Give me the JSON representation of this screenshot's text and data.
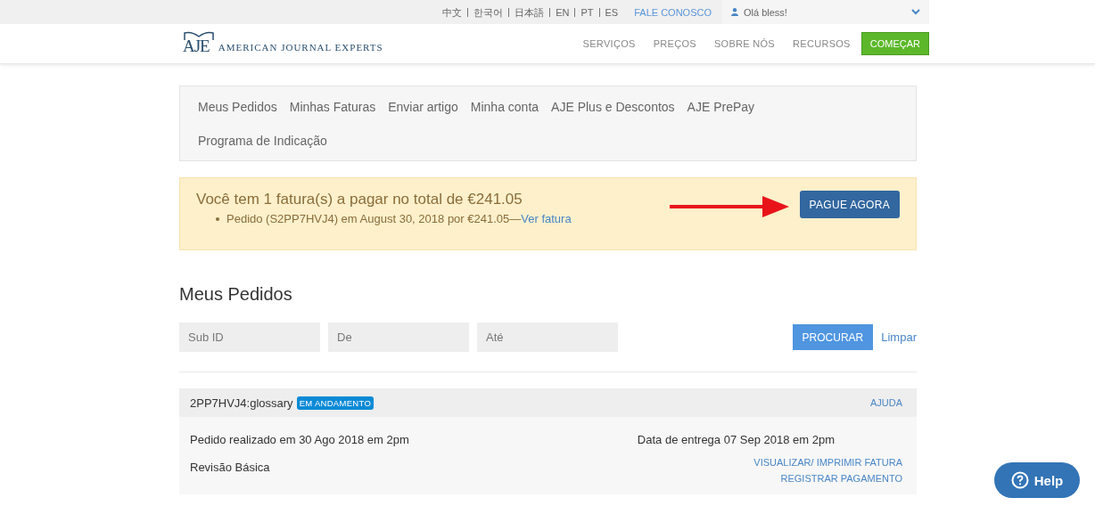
{
  "top_bar": {
    "languages": [
      "中文",
      "한국어",
      "日本語",
      "EN",
      "PT",
      "ES"
    ],
    "contact": "FALE CONOSCO",
    "user": "Olá bless!"
  },
  "header": {
    "logo_mark": "AJE",
    "logo_text": "AMERICAN JOURNAL EXPERTS",
    "nav": [
      "SERVIÇOS",
      "PREÇOS",
      "SOBRE NÓS",
      "RECURSOS"
    ],
    "cta": "COMEÇAR"
  },
  "tabs": [
    {
      "label": "Meus Pedidos",
      "selected": false
    },
    {
      "label": "Minhas Faturas",
      "selected": false
    },
    {
      "label": "Enviar artigo",
      "selected": false
    },
    {
      "label": "Minha conta",
      "selected": false
    },
    {
      "label": "AJE Plus e Descontos",
      "selected": false
    },
    {
      "label": "AJE PrePay",
      "selected": false
    },
    {
      "label": "Programa de Indicação",
      "selected": false
    }
  ],
  "alert": {
    "title": "Você tem 1 fatura(s) a pagar no total de €241.05",
    "item": "Pedido (S2PP7HVJ4) em August 30, 2018 por €241.05—",
    "item_link": "Ver fatura",
    "button": "PAGUE AGORA"
  },
  "orders_title": "Meus Pedidos",
  "filters": [
    {
      "placeholder": "Sub ID"
    },
    {
      "placeholder": "De"
    },
    {
      "placeholder": "Até"
    }
  ],
  "search_button": "PROCURAR",
  "clear_link": "Limpar",
  "orders": [
    {
      "id": "2PP7HVJ4:glossary",
      "status": "EM ANDAMENTO",
      "help": "AJUDA",
      "placed": "Pedido realizado em 30 Ago 2018 em 2pm",
      "delivery": "Data de entrega 07 Sep 2018 em 2pm",
      "service": "Revisão Básica",
      "actions": [
        "VISUALIZAR/ IMPRIMIR FATURA",
        "REGISTRAR PAGAMENTO"
      ]
    }
  ],
  "help_button": "Help"
}
